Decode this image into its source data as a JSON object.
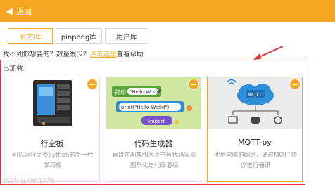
{
  "header": {
    "back_label": "返回",
    "bg_color": "#f5a623"
  },
  "tabs": [
    {
      "label": "官方库",
      "active": true
    },
    {
      "label": "pinpong库",
      "active": false
    },
    {
      "label": "用户库",
      "active": false
    }
  ],
  "help": {
    "prefix": "找不到你想要的？数量很少？",
    "link": "点击这里",
    "suffix": "查看帮助"
  },
  "loaded_label": "已加载:",
  "cards": [
    {
      "title": "行空板",
      "desc": "可以运行完整python的新一代学习板",
      "icon": "board-photo"
    },
    {
      "title": "代码生成器",
      "desc": "直接在图像积木上书写代码实现图形化与代码混编",
      "icon": "code-blocks",
      "block_labels": {
        "print_text": "打印",
        "hello_one": "\"Hello World\"",
        "hello_two": "print(\"Hello World\")",
        "import_label": "import"
      }
    },
    {
      "title": "MQTT-py",
      "desc": "使用电脑的网络，通过MQTT协议进行通讯",
      "icon": "mqtt-cloud",
      "cloud_label": "MQTT"
    }
  ],
  "watermark": "CSDN @网络工程师"
}
